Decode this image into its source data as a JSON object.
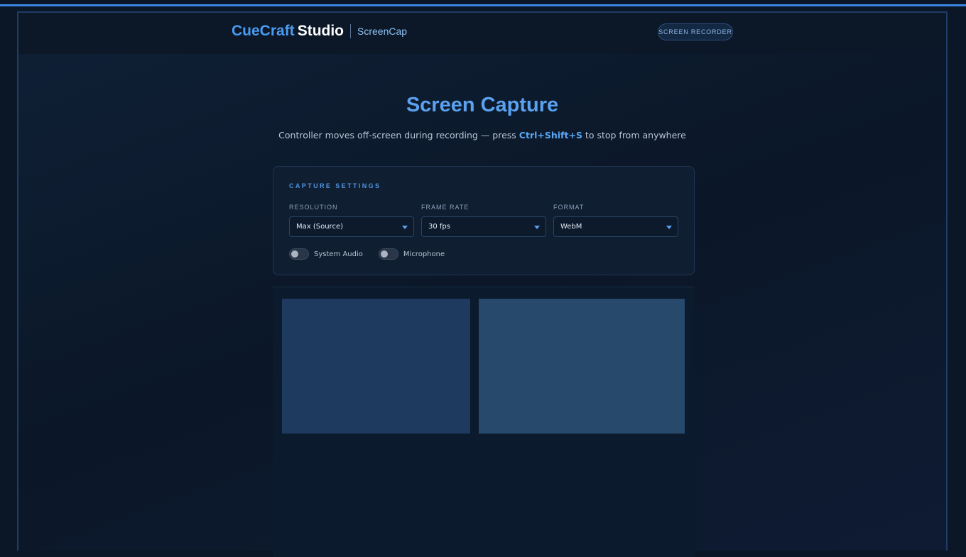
{
  "header": {
    "brand_accent": "CueCraft",
    "brand_main": "Studio",
    "brand_sub": "ScreenCap",
    "badge": "SCREEN RECORDER"
  },
  "main": {
    "title": "Screen Capture",
    "subtitle_before": "Controller moves off-screen during recording — press ",
    "shortcut": "Ctrl+Shift+S",
    "subtitle_after": " to stop from anywhere"
  },
  "settings": {
    "title": "CAPTURE SETTINGS",
    "fields": [
      {
        "label": "RESOLUTION",
        "value": "Max (Source)"
      },
      {
        "label": "FRAME RATE",
        "value": "30 fps"
      },
      {
        "label": "FORMAT",
        "value": "WebM"
      }
    ],
    "toggles": [
      {
        "label": "System Audio",
        "on": false
      },
      {
        "label": "Microphone",
        "on": false
      }
    ]
  },
  "colors": {
    "accent": "#4a9bf0",
    "top_bar": "#3d86e8",
    "background": "#0b1626"
  }
}
